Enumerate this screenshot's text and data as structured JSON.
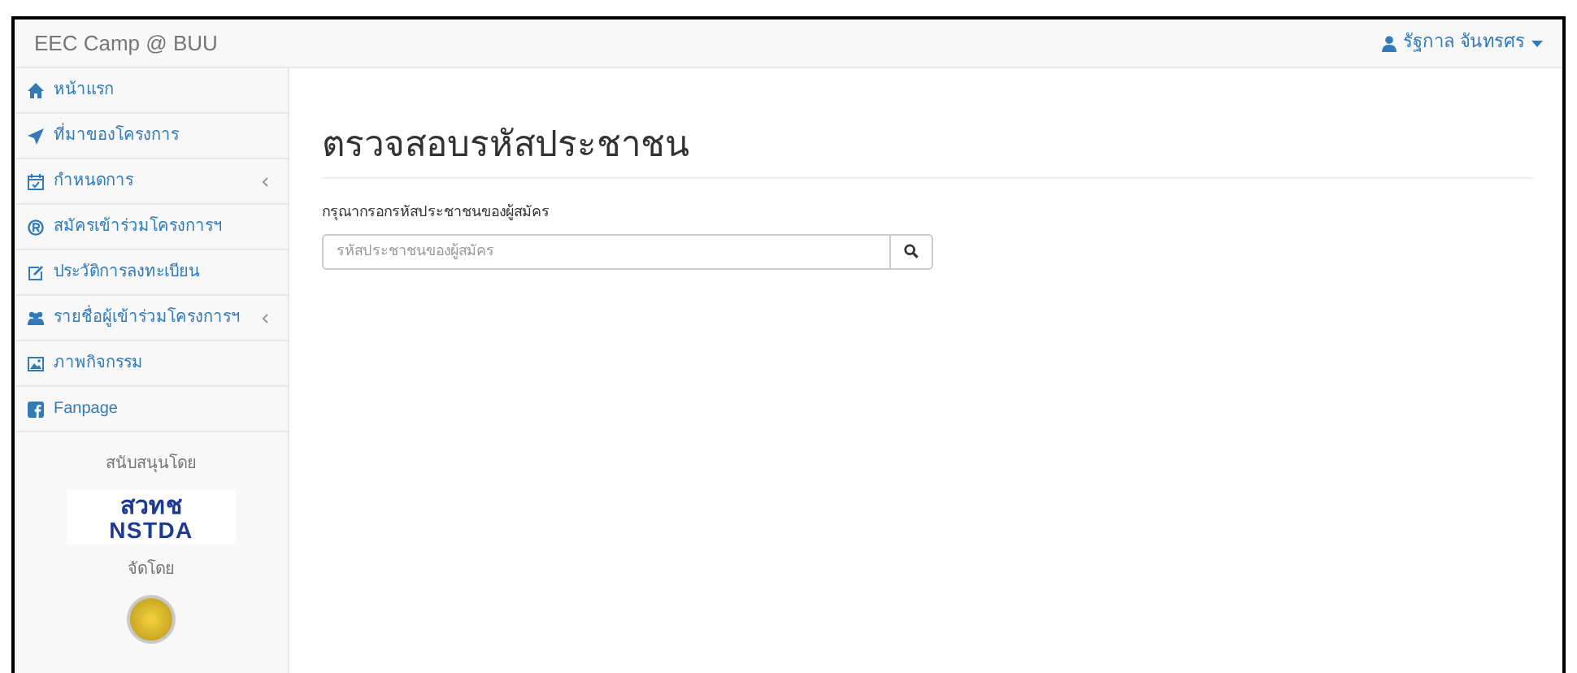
{
  "navbar": {
    "brand": "EEC Camp @ BUU",
    "user": "รัฐกาล จันทรศร"
  },
  "sidebar": {
    "items": [
      {
        "kind": "home",
        "label": "หน้าแรก",
        "has_submenu": false
      },
      {
        "kind": "send",
        "label": "ที่มาของโครงการ",
        "has_submenu": false
      },
      {
        "kind": "calendar",
        "label": "กำหนดการ",
        "has_submenu": true
      },
      {
        "kind": "registered",
        "label": "สมัครเข้าร่วมโครงการฯ",
        "has_submenu": false
      },
      {
        "kind": "edit",
        "label": "ประวัติการลงทะเบียน",
        "has_submenu": false
      },
      {
        "kind": "users",
        "label": "รายชื่อผู้เข้าร่วมโครงการฯ",
        "has_submenu": true
      },
      {
        "kind": "image",
        "label": "ภาพกิจกรรม",
        "has_submenu": false
      },
      {
        "kind": "facebook",
        "label": "Fanpage",
        "has_submenu": false
      }
    ],
    "supported_by": "สนับสนุนโดย",
    "sponsor_logo": {
      "thai": "สวทช",
      "latin": "NSTDA"
    },
    "organized_by": "จัดโดย"
  },
  "main": {
    "title": "ตรวจสอบรหัสประชาชน",
    "field_label": "กรุณากรอกรหัสประชาชนของผู้สมัคร",
    "search": {
      "placeholder": "รหัสประชาชนของผู้สมัคร"
    }
  }
}
